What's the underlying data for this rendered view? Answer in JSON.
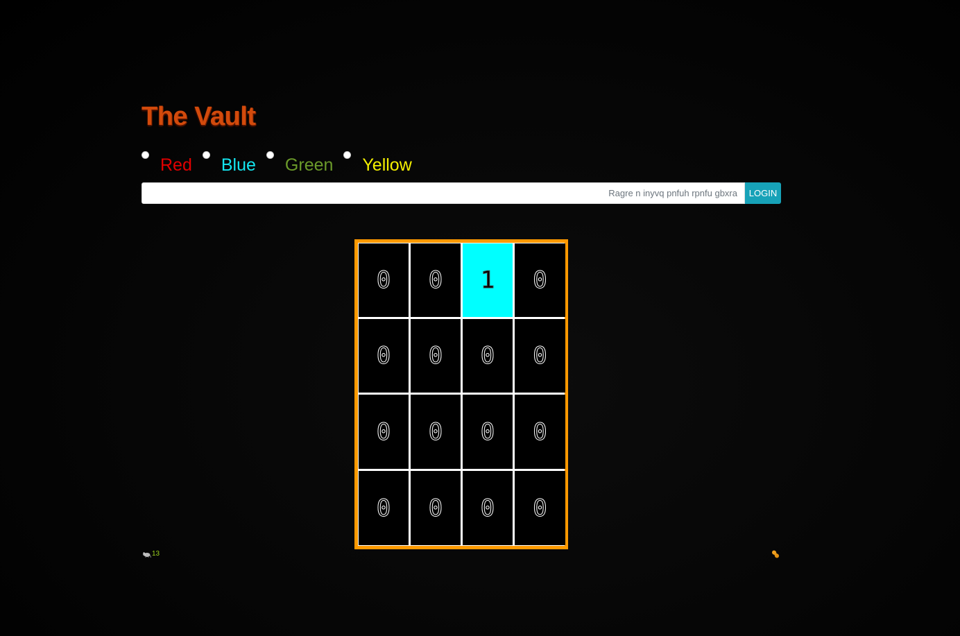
{
  "app": {
    "title": "The Vault"
  },
  "colors": [
    {
      "label": "Red",
      "color": "#e00000"
    },
    {
      "label": "Blue",
      "color": "#14e6f0"
    },
    {
      "label": "Green",
      "color": "#6b9a2a"
    },
    {
      "label": "Yellow",
      "color": "#f4f000"
    }
  ],
  "search": {
    "value": "",
    "placeholder": "Ragre n inyvq pnfuh rpnfu gbxra",
    "button_label": "LOGIN"
  },
  "grid": {
    "rows": [
      [
        "0",
        "0",
        "1",
        "0"
      ],
      [
        "0",
        "0",
        "0",
        "0"
      ],
      [
        "0",
        "0",
        "0",
        "0"
      ],
      [
        "0",
        "0",
        "0",
        "0"
      ]
    ],
    "highlight_color": "#00ffff",
    "border_color": "#ff9900"
  },
  "footer": {
    "count": "13",
    "left_icon": "rat-icon",
    "right_icon": "peanut-icon"
  }
}
